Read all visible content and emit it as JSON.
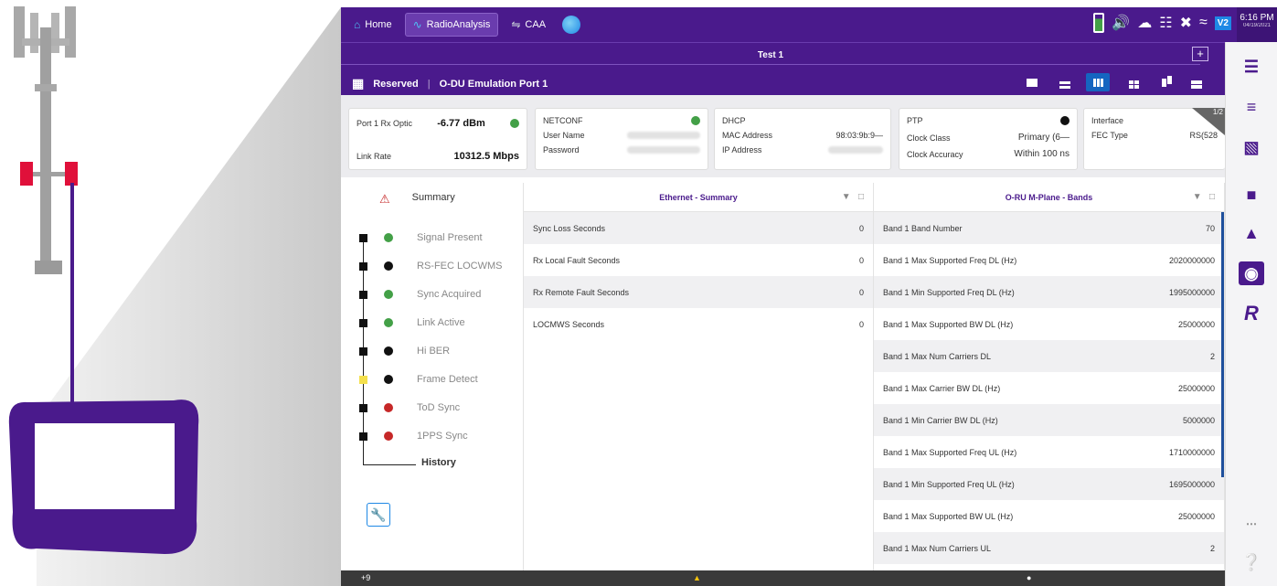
{
  "tabs": [
    {
      "label": "Home",
      "icon": "home-icon"
    },
    {
      "label": "RadioAnalysis",
      "icon": "waveform-icon",
      "active": true
    },
    {
      "label": "CAA",
      "icon": "caa-icon"
    }
  ],
  "status": {
    "badge": "V2",
    "time": "6:16 PM",
    "date": "04/19/2021"
  },
  "test_title": "Test 1",
  "breadcrumb": {
    "first": "Reserved",
    "second": "O-DU Emulation Port 1"
  },
  "cards": {
    "port": {
      "opt_label": "Port 1 Rx Optic",
      "opt_value": "-6.77 dBm",
      "rate_label": "Link Rate",
      "rate_value": "10312.5 Mbps"
    },
    "netconf": {
      "title": "NETCONF",
      "user_label": "User Name",
      "pass_label": "Password"
    },
    "dhcp": {
      "title": "DHCP",
      "mac_label": "MAC Address",
      "mac_value": "98:03:9b:9—",
      "ip_label": "IP Address"
    },
    "ptp": {
      "title": "PTP",
      "class_label": "Clock Class",
      "class_value": "Primary (6—",
      "acc_label": "Clock Accuracy",
      "acc_value": "Within 100 ns"
    },
    "iface": {
      "title": "Interface",
      "fec_label": "FEC Type",
      "fec_value": "RS(528"
    },
    "page": "1/2"
  },
  "summary": {
    "title": "Summary",
    "items": [
      {
        "label": "Signal Present",
        "dot": "green",
        "sq": "black"
      },
      {
        "label": "RS-FEC LOCWMS",
        "dot": "black",
        "sq": "black"
      },
      {
        "label": "Sync Acquired",
        "dot": "green",
        "sq": "black"
      },
      {
        "label": "Link Active",
        "dot": "green",
        "sq": "black"
      },
      {
        "label": "Hi BER",
        "dot": "black",
        "sq": "black"
      },
      {
        "label": "Frame Detect",
        "dot": "black",
        "sq": "yellow"
      },
      {
        "label": "ToD Sync",
        "dot": "red",
        "sq": "black"
      },
      {
        "label": "1PPS Sync",
        "dot": "red",
        "sq": "black"
      }
    ],
    "history": "History"
  },
  "ethernet": {
    "title": "Ethernet - Summary",
    "rows": [
      {
        "label": "Sync Loss Seconds",
        "value": "0"
      },
      {
        "label": "Rx Local Fault Seconds",
        "value": "0"
      },
      {
        "label": "Rx Remote Fault Seconds",
        "value": "0"
      },
      {
        "label": "LOCMWS Seconds",
        "value": "0"
      }
    ]
  },
  "bands": {
    "title": "O-RU M-Plane - Bands",
    "rows": [
      {
        "label": "Band 1 Band Number",
        "value": "70"
      },
      {
        "label": "Band 1 Max Supported Freq DL (Hz)",
        "value": "2020000000"
      },
      {
        "label": "Band 1 Min Supported Freq DL (Hz)",
        "value": "1995000000"
      },
      {
        "label": "Band 1 Max Supported BW DL (Hz)",
        "value": "25000000"
      },
      {
        "label": "Band 1 Max Num Carriers DL",
        "value": "2"
      },
      {
        "label": "Band 1 Max Carrier BW DL (Hz)",
        "value": "25000000"
      },
      {
        "label": "Band 1  Min Carrier BW DL (Hz)",
        "value": "5000000"
      },
      {
        "label": "Band 1 Max Supported Freq UL (Hz)",
        "value": "1710000000"
      },
      {
        "label": "Band 1 Min Supported Freq UL (Hz)",
        "value": "1695000000"
      },
      {
        "label": "Band 1 Max Supported BW UL (Hz)",
        "value": "25000000"
      },
      {
        "label": "Band 1 Max Num Carriers UL",
        "value": "2"
      }
    ]
  },
  "bottom": {
    "left": "+9"
  },
  "colors": {
    "brand": "#4a1a8c",
    "antenna": "#a8a8a8",
    "radio_red": "#e0103a"
  }
}
